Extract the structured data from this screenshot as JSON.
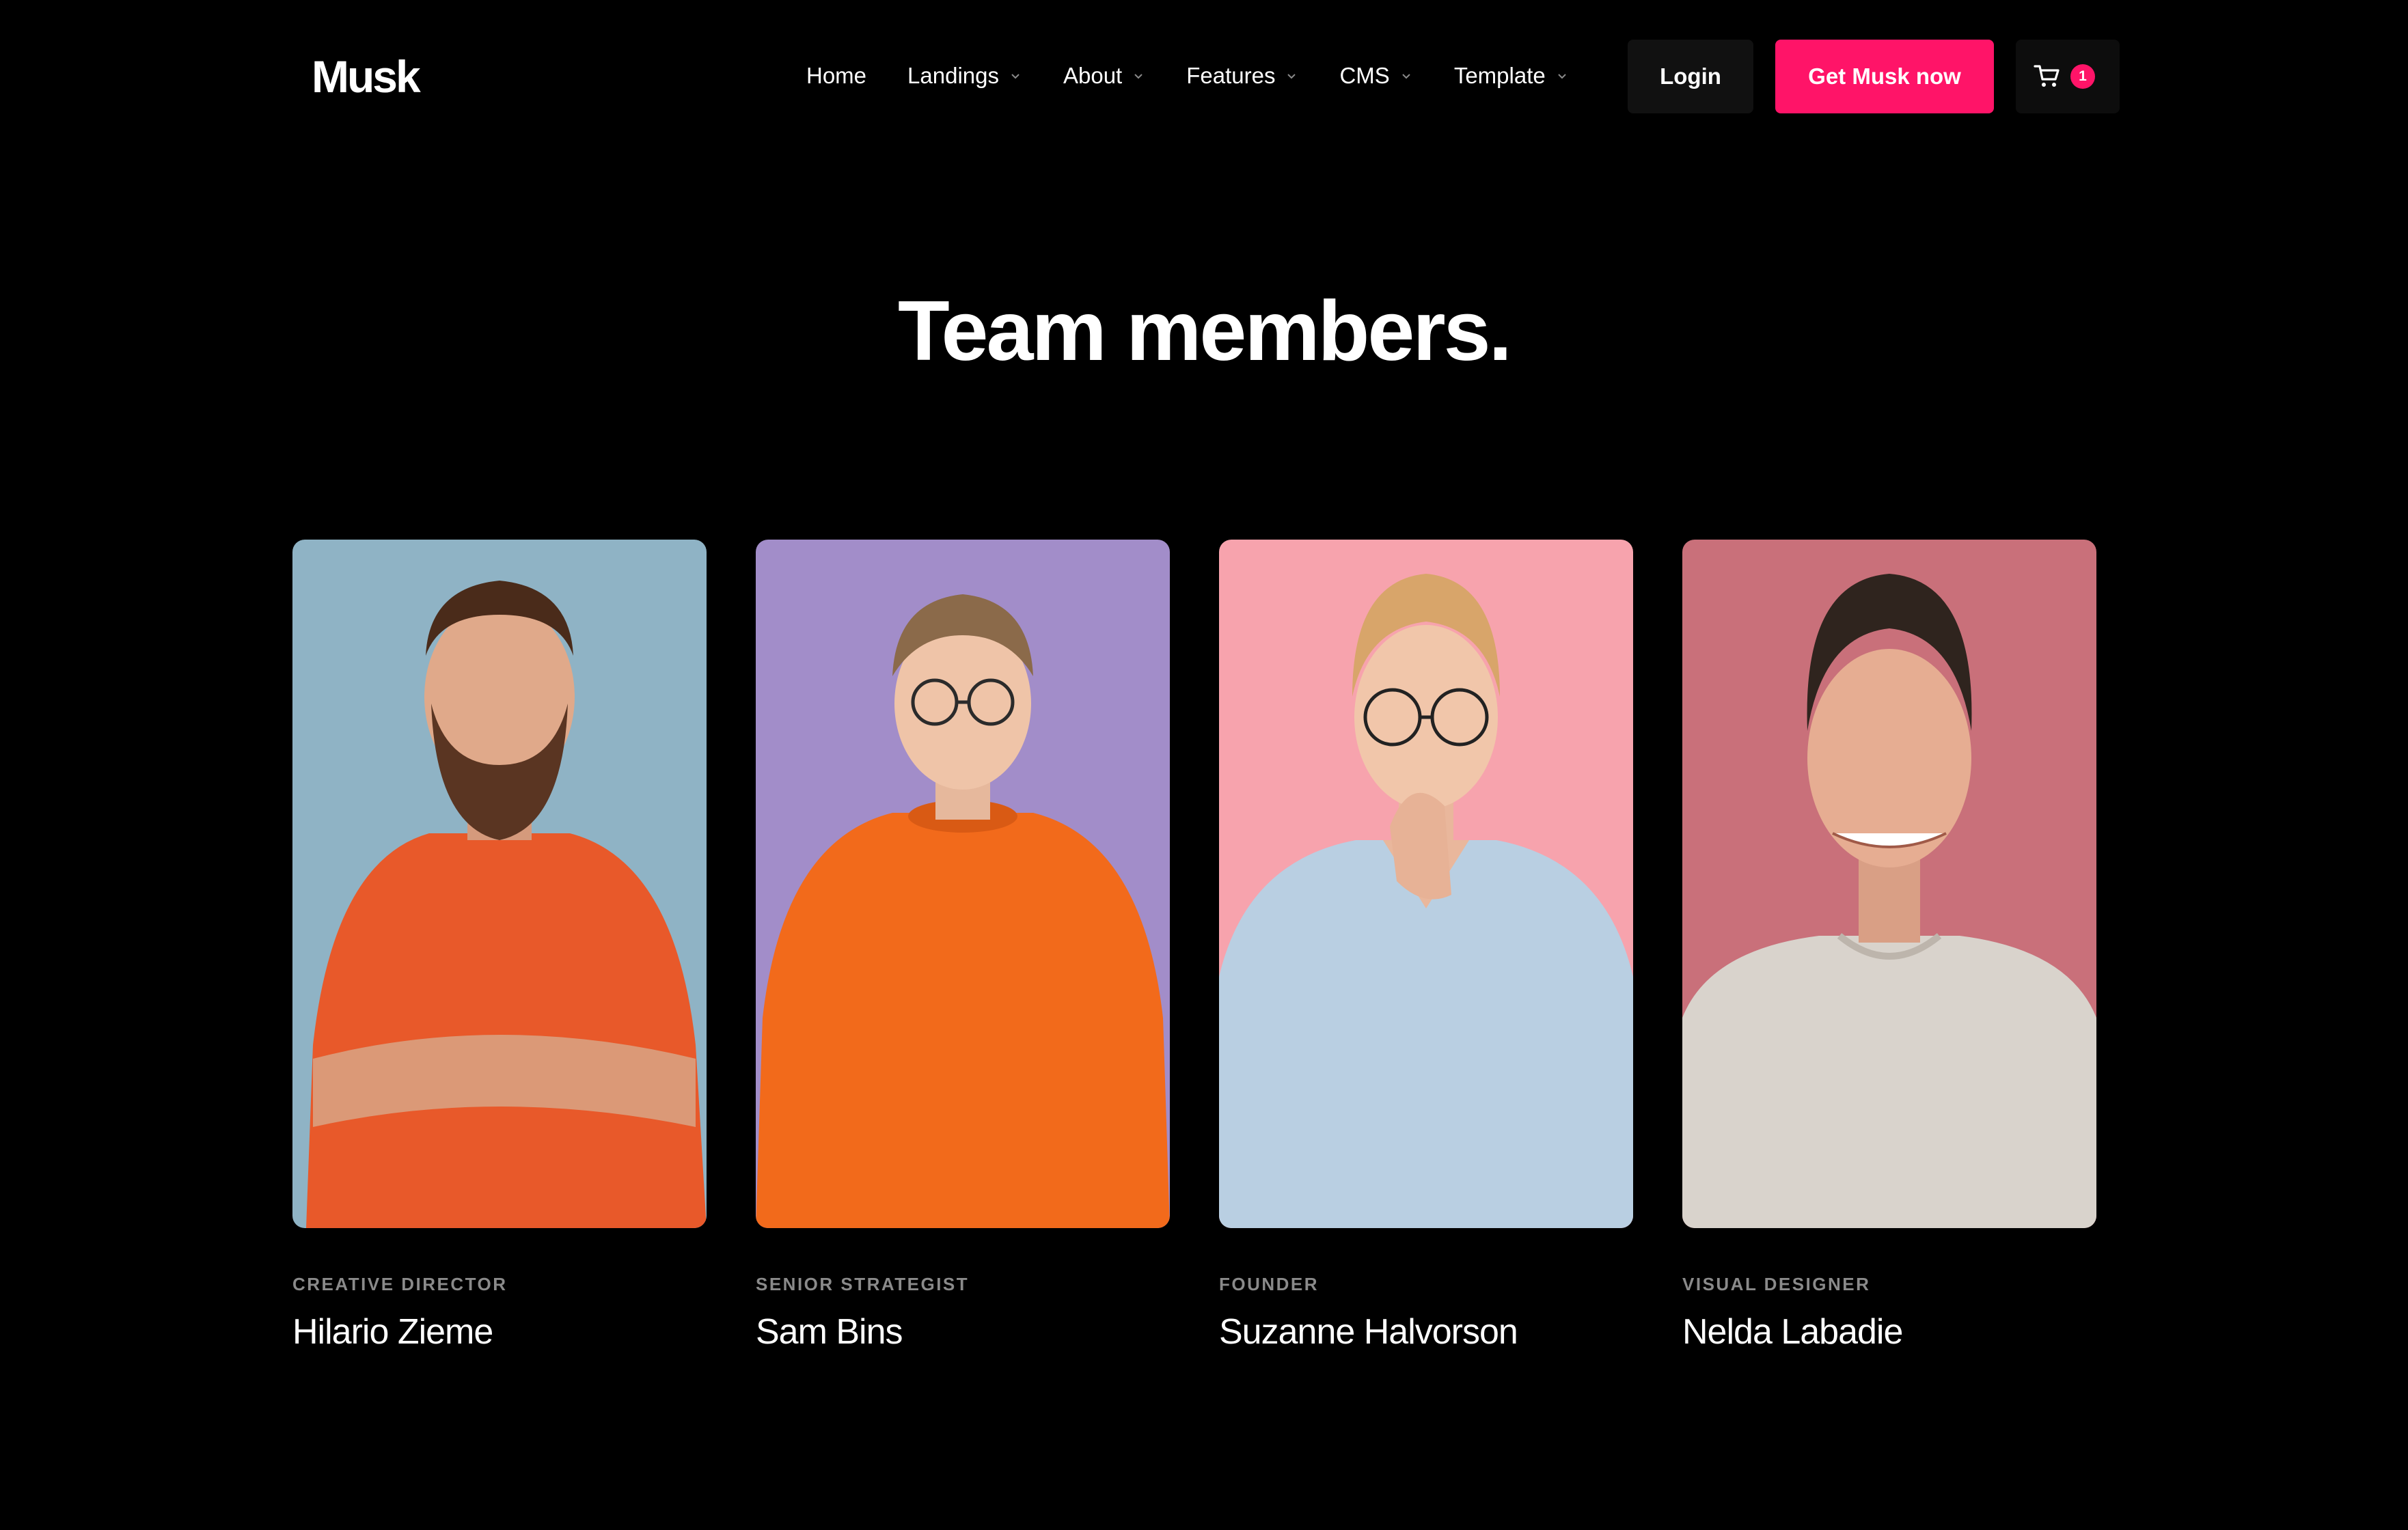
{
  "brand": {
    "logo": "Musk",
    "accent_color": "#ff1468"
  },
  "nav": {
    "items": [
      {
        "label": "Home",
        "has_dropdown": false
      },
      {
        "label": "Landings",
        "has_dropdown": true
      },
      {
        "label": "About",
        "has_dropdown": true
      },
      {
        "label": "Features",
        "has_dropdown": true
      },
      {
        "label": "CMS",
        "has_dropdown": true
      },
      {
        "label": "Template",
        "has_dropdown": true
      }
    ],
    "login_label": "Login",
    "cta_label": "Get Musk now",
    "cart_count": "1",
    "cart_icon": "cart-icon",
    "dropdown_icon": "chevron-down-icon"
  },
  "page": {
    "title": "Team members."
  },
  "team": [
    {
      "role": "CREATIVE DIRECTOR",
      "name": "Hilario Zieme",
      "photo_bg": "#8fb3c5",
      "shirt": "#e8592a"
    },
    {
      "role": "SENIOR STRATEGIST",
      "name": "Sam Bins",
      "photo_bg": "#a28dc9",
      "shirt": "#f26a1b"
    },
    {
      "role": "FOUNDER",
      "name": "Suzanne Halvorson",
      "photo_bg": "#f7a3ad",
      "shirt": "#b9cfe2"
    },
    {
      "role": "VISUAL DESIGNER",
      "name": "Nelda Labadie",
      "photo_bg": "#c9707a",
      "shirt": "#d9d3cc"
    }
  ]
}
